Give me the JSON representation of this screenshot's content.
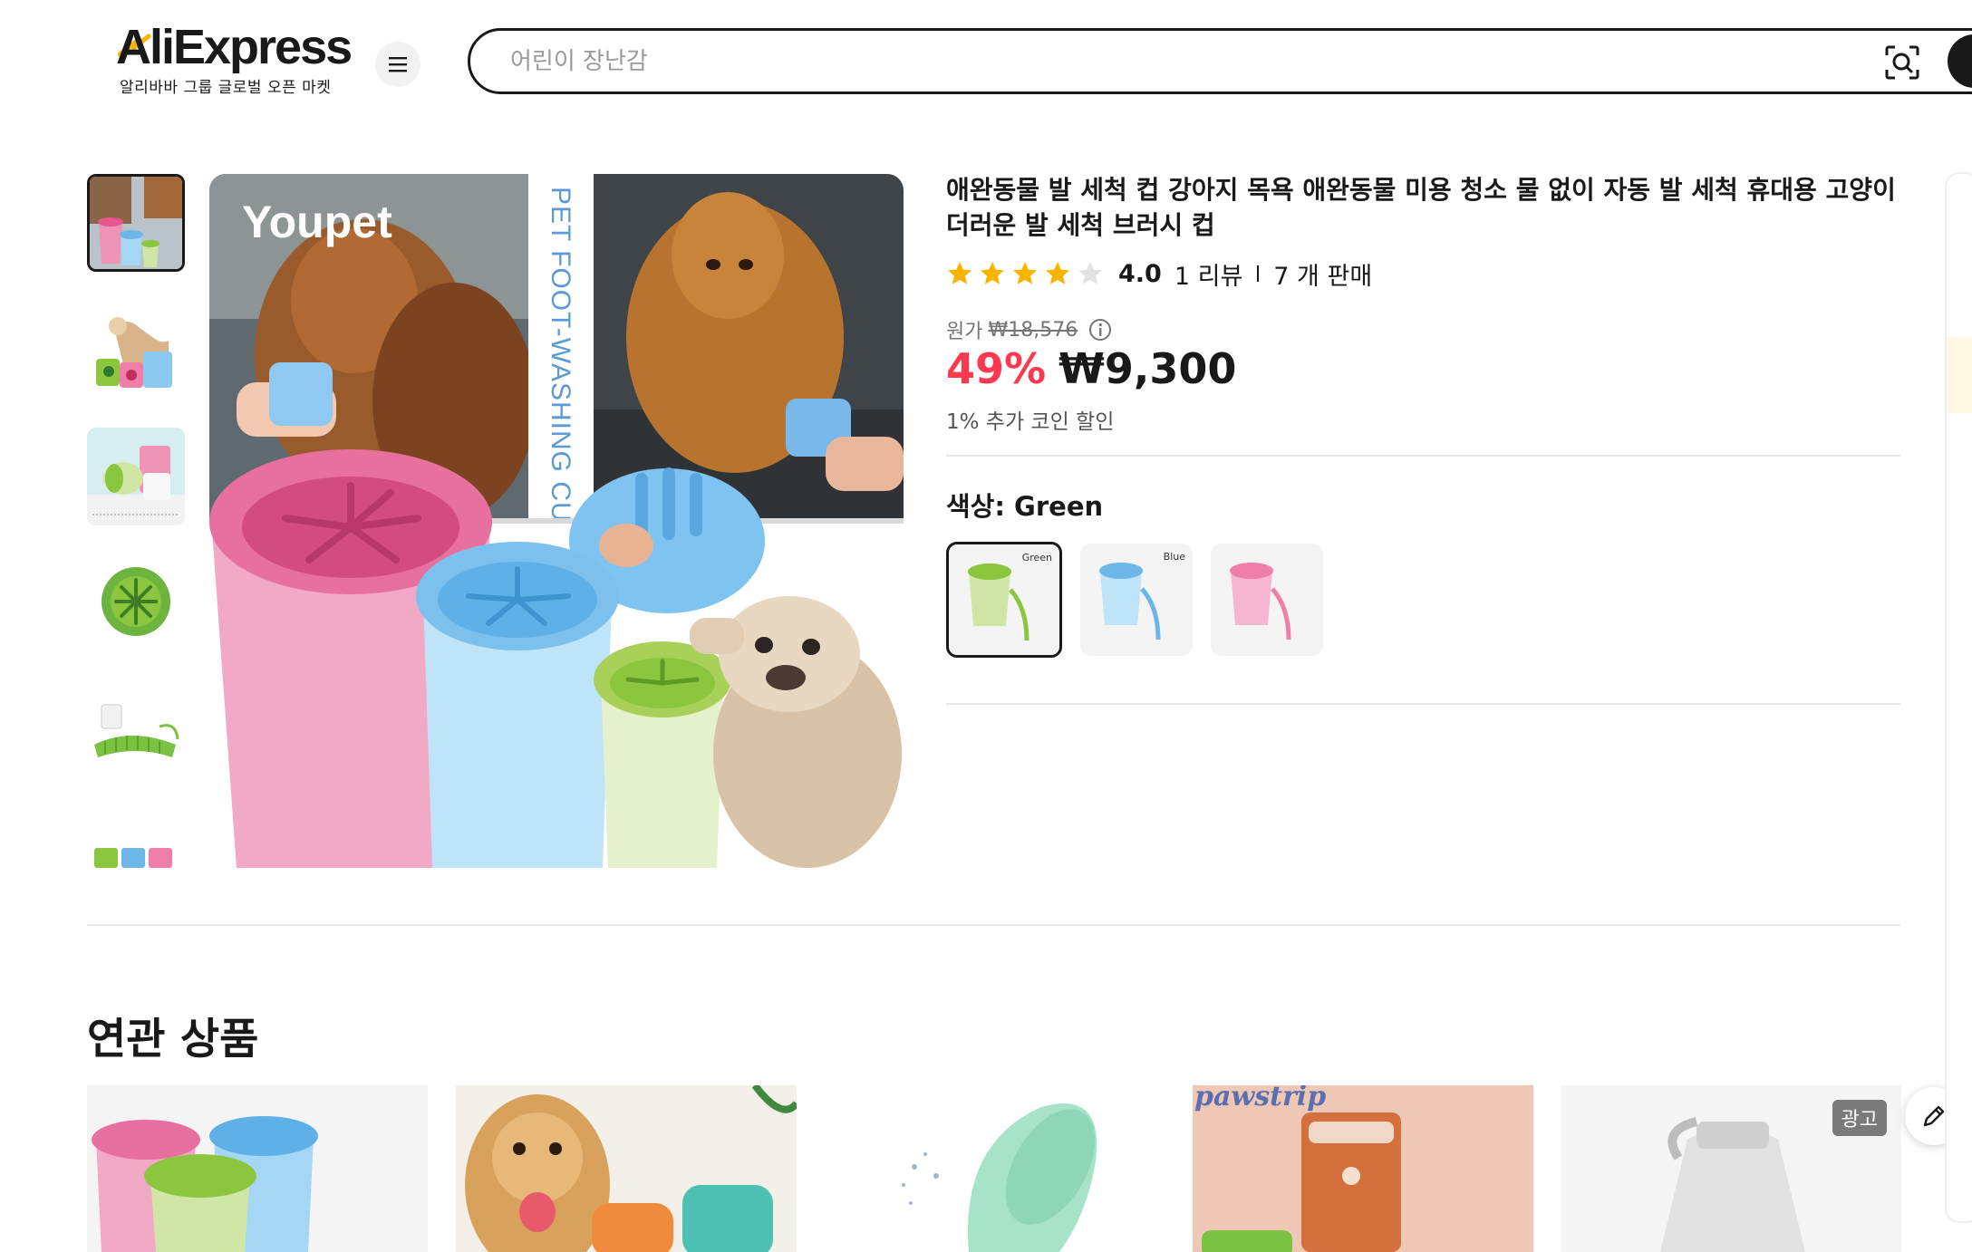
{
  "header": {
    "logo_text": "AliExpress",
    "logo_subtitle": "알리바바 그룹 글로벌 오픈 마켓",
    "search_placeholder": "어린이 장난감"
  },
  "product": {
    "title": "애완동물 발 세척 컵 강아지 목욕 애완동물 미용 청소 물 없이 자동 발 세척 휴대용 고양이 더러운 발 세척 브러시 컵",
    "rating": {
      "stars_filled": 4,
      "stars_total": 5,
      "score": "4.0",
      "reviews": "1 리뷰",
      "sold": "7 개 판매"
    },
    "original_price_label": "원가",
    "original_price": "₩18,576",
    "discount": "49%",
    "price": "₩9,300",
    "coin_discount": "1% 추가 코인 할인",
    "color_label": "색상: Green",
    "colors": [
      {
        "name": "Green",
        "label": "Green",
        "accent": "#8cc63f",
        "selected": true
      },
      {
        "name": "Blue",
        "label": "Blue",
        "accent": "#6eb6e8",
        "selected": false
      },
      {
        "name": "Pink",
        "label": "",
        "accent": "#ef7fa8",
        "selected": false
      }
    ],
    "main_image_text": {
      "brand": "Youpet",
      "banner": "PET FOOT-WASHING CUP"
    }
  },
  "related": {
    "title": "연관 상품",
    "card_brand": "pawstrip",
    "ad_badge": "광고"
  },
  "colors": {
    "discount_red": "#fd384f",
    "text_dark": "#191919",
    "star_gold": "#f7b500"
  }
}
